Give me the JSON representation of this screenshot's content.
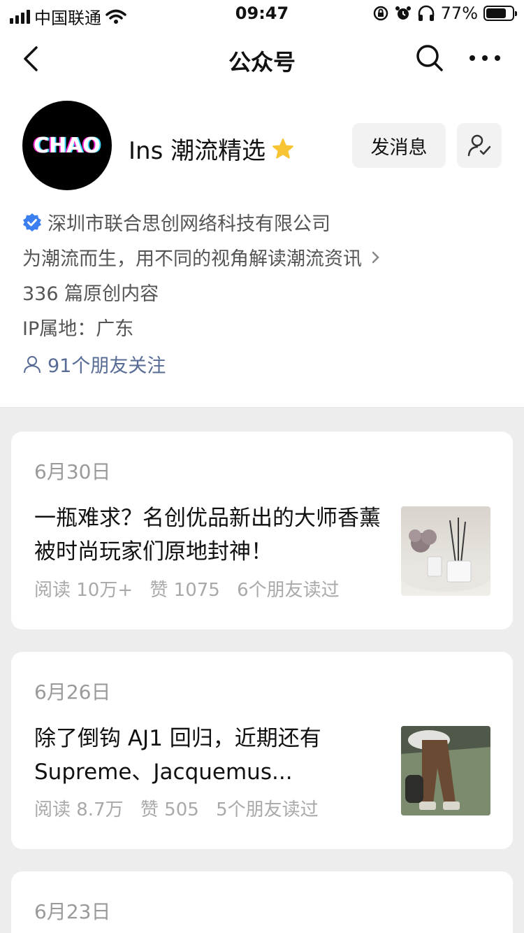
{
  "status_bar": {
    "carrier": "中国联通",
    "time": "09:47",
    "battery": "77%"
  },
  "nav": {
    "title": "公众号"
  },
  "profile": {
    "avatar_text": "CHAO",
    "name": "Ins 潮流精选",
    "message_button": "发消息",
    "company": "深圳市联合思创网络科技有限公司",
    "description": "为潮流而生，用不同的视角解读潮流资讯",
    "original_count": "336 篇原创内容",
    "ip_location": "IP属地：广东",
    "friends_following": "91个朋友关注"
  },
  "articles": [
    {
      "date": "6月30日",
      "title": "一瓶难求？名创优品新出的大师香薰被时尚玩家们原地封神！",
      "reads": "阅读 10万+",
      "likes": "赞 1075",
      "friends_read": "6个朋友读过"
    },
    {
      "date": "6月26日",
      "title": "除了倒钩 AJ1 回归，近期还有 Supreme、Jacquemus...",
      "reads": "阅读 8.7万",
      "likes": "赞 505",
      "friends_read": "5个朋友读过"
    },
    {
      "date": "6月23日"
    }
  ]
}
